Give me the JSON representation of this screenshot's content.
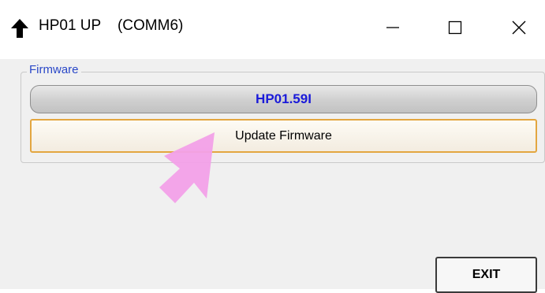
{
  "window": {
    "title": "HP01 UP    (COMM6)",
    "icons": {
      "app": "up-arrow-icon",
      "minimize": "minimize-icon",
      "maximize": "maximize-icon",
      "close": "close-icon"
    }
  },
  "firmware_group": {
    "legend": "Firmware",
    "version": "HP01.59I",
    "update_button_label": "Update Firmware"
  },
  "overlay": {
    "pointer_icon": "pink-arrow-icon",
    "pointer_color": "#f2a0e8"
  },
  "footer": {
    "exit_button_label": "EXIT"
  },
  "colors": {
    "version_text": "#1a1ad9",
    "legend_text": "#2a48c8",
    "update_border": "#e3a640"
  }
}
